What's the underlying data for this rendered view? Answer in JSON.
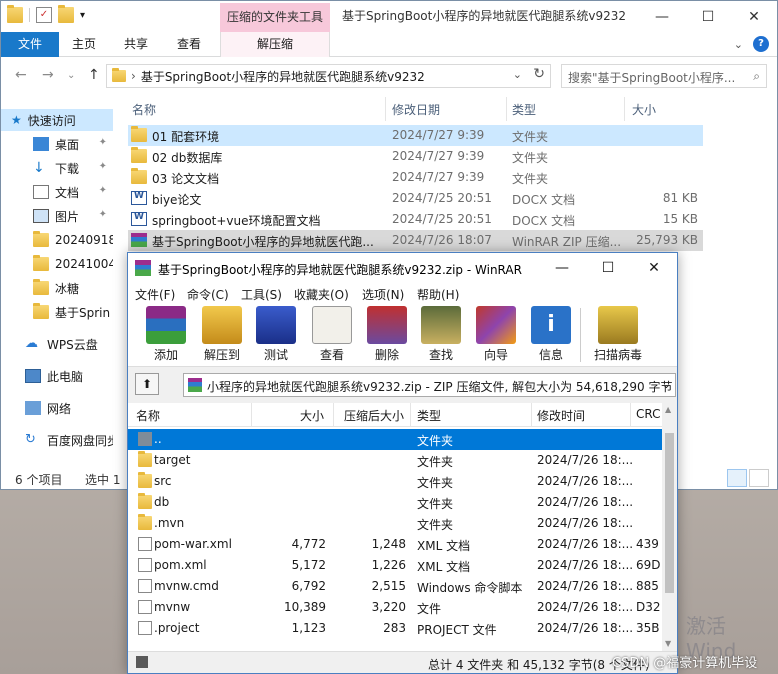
{
  "explorer": {
    "ctx_tab_title": "压缩的文件夹工具",
    "window_title": "基于SpringBoot小程序的异地就医代跑腿系统v9232",
    "win_controls": {
      "minimize": "—",
      "maximize": "☐",
      "close": "✕"
    },
    "ribbon_tabs": [
      "文件",
      "主页",
      "共享",
      "查看",
      "解压缩"
    ],
    "address": {
      "path": "基于SpringBoot小程序的异地就医代跑腿系统v9232",
      "search_placeholder": "搜索\"基于SpringBoot小程序..."
    },
    "nav": {
      "quick_access": "快速访问",
      "items": [
        "桌面",
        "下载",
        "文档",
        "图片",
        "20240918",
        "20241004",
        "冰糖",
        "基于Sprin"
      ],
      "wps": "WPS云盘",
      "this_pc": "此电脑",
      "network": "网络",
      "baidu": "百度网盘同步"
    },
    "columns": {
      "name": "名称",
      "date": "修改日期",
      "type": "类型",
      "size": "大小"
    },
    "files": [
      {
        "name": "01 配套环境",
        "date": "2024/7/27 9:39",
        "type": "文件夹",
        "size": "",
        "icon": "folder"
      },
      {
        "name": "02 db数据库",
        "date": "2024/7/27 9:39",
        "type": "文件夹",
        "size": "",
        "icon": "folder"
      },
      {
        "name": "03 论文文档",
        "date": "2024/7/27 9:39",
        "type": "文件夹",
        "size": "",
        "icon": "folder"
      },
      {
        "name": "biye论文",
        "date": "2024/7/25 20:51",
        "type": "DOCX 文档",
        "size": "81 KB",
        "icon": "docx"
      },
      {
        "name": "springboot+vue环境配置文档",
        "date": "2024/7/25 20:51",
        "type": "DOCX 文档",
        "size": "15 KB",
        "icon": "docx"
      },
      {
        "name": "基于SpringBoot小程序的异地就医代跑...",
        "date": "2024/7/26 18:07",
        "type": "WinRAR ZIP 压缩...",
        "size": "25,793 KB",
        "icon": "rar"
      }
    ],
    "status": {
      "count": "6 个项目",
      "selected": "选中 1"
    }
  },
  "winrar": {
    "title": "基于SpringBoot小程序的异地就医代跑腿系统v9232.zip - WinRAR",
    "menu": [
      "文件(F)",
      "命令(C)",
      "工具(S)",
      "收藏夹(O)",
      "选项(N)",
      "帮助(H)"
    ],
    "toolbar": [
      "添加",
      "解压到",
      "测试",
      "查看",
      "删除",
      "查找",
      "向导",
      "信息",
      "扫描病毒"
    ],
    "path_text": "小程序的异地就医代跑腿系统v9232.zip - ZIP 压缩文件, 解包大小为 54,618,290 字节",
    "columns": {
      "name": "名称",
      "size": "大小",
      "packed": "压缩后大小",
      "type": "类型",
      "mtime": "修改时间",
      "crc": "CRC"
    },
    "rows": [
      {
        "name": "..",
        "size": "",
        "packed": "",
        "type": "文件夹",
        "mtime": "",
        "crc": "",
        "icon": "up"
      },
      {
        "name": "target",
        "size": "",
        "packed": "",
        "type": "文件夹",
        "mtime": "2024/7/26 18:...",
        "crc": "",
        "icon": "folder"
      },
      {
        "name": "src",
        "size": "",
        "packed": "",
        "type": "文件夹",
        "mtime": "2024/7/26 18:...",
        "crc": "",
        "icon": "folder"
      },
      {
        "name": "db",
        "size": "",
        "packed": "",
        "type": "文件夹",
        "mtime": "2024/7/26 18:...",
        "crc": "",
        "icon": "folder"
      },
      {
        "name": ".mvn",
        "size": "",
        "packed": "",
        "type": "文件夹",
        "mtime": "2024/7/26 18:...",
        "crc": "",
        "icon": "folder"
      },
      {
        "name": "pom-war.xml",
        "size": "4,772",
        "packed": "1,248",
        "type": "XML 文档",
        "mtime": "2024/7/26 18:...",
        "crc": "439",
        "icon": "file"
      },
      {
        "name": "pom.xml",
        "size": "5,172",
        "packed": "1,226",
        "type": "XML 文档",
        "mtime": "2024/7/26 18:...",
        "crc": "69D",
        "icon": "file"
      },
      {
        "name": "mvnw.cmd",
        "size": "6,792",
        "packed": "2,515",
        "type": "Windows 命令脚本",
        "mtime": "2024/7/26 18:...",
        "crc": "885",
        "icon": "file"
      },
      {
        "name": "mvnw",
        "size": "10,389",
        "packed": "3,220",
        "type": "文件",
        "mtime": "2024/7/26 18:...",
        "crc": "D32",
        "icon": "file"
      },
      {
        "name": ".project",
        "size": "1,123",
        "packed": "283",
        "type": "PROJECT 文件",
        "mtime": "2024/7/26 18:...",
        "crc": "35B",
        "icon": "file"
      }
    ],
    "status": "总计 4 文件夹 和 45,132 字节(8 个文件)"
  },
  "watermark": "激活 Wind",
  "csdn": "CSDN @福豪计算机毕设",
  "colors": {
    "accent": "#1979ca",
    "ctx_tab": "#f7c8da",
    "selection": "#cce8ff",
    "wr_selection": "#0078d7"
  }
}
